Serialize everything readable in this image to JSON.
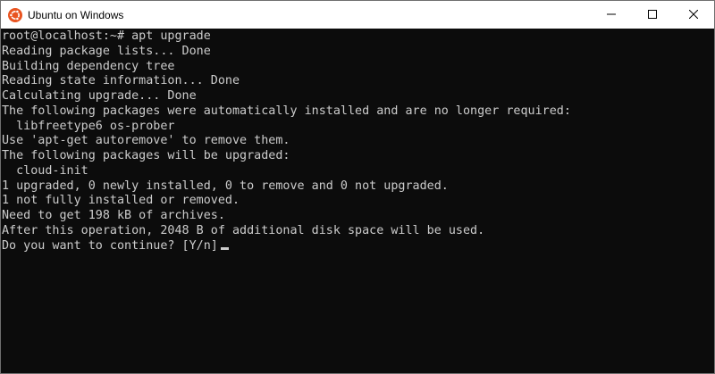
{
  "window": {
    "title": "Ubuntu on Windows",
    "app_icon": "ubuntu-logo-icon",
    "controls": [
      "minimize-icon",
      "maximize-icon",
      "close-icon"
    ],
    "accent_color": "#e95420"
  },
  "terminal": {
    "background": "#0c0c0c",
    "foreground": "#cccccc",
    "lines": [
      "root@localhost:~# apt upgrade",
      "Reading package lists... Done",
      "Building dependency tree",
      "Reading state information... Done",
      "Calculating upgrade... Done",
      "The following packages were automatically installed and are no longer required:",
      "  libfreetype6 os-prober",
      "Use 'apt-get autoremove' to remove them.",
      "The following packages will be upgraded:",
      "  cloud-init",
      "1 upgraded, 0 newly installed, 0 to remove and 0 not upgraded.",
      "1 not fully installed or removed.",
      "Need to get 198 kB of archives.",
      "After this operation, 2048 B of additional disk space will be used.",
      "Do you want to continue? [Y/n]"
    ]
  }
}
